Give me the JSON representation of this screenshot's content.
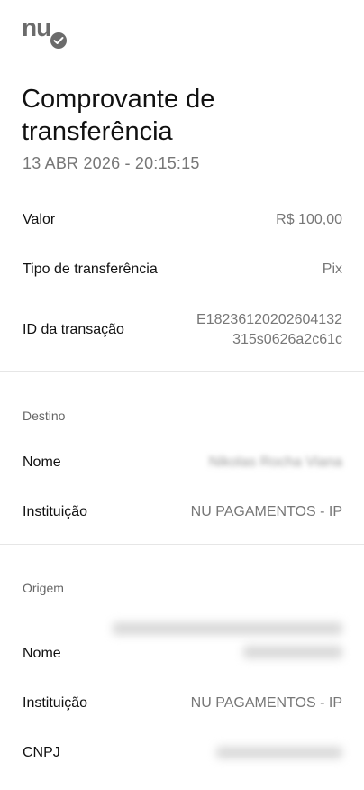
{
  "brand": {
    "logo_text": "nu"
  },
  "header": {
    "title": "Comprovante de transferência",
    "timestamp": "13 ABR 2026 - 20:15:15"
  },
  "summary": {
    "valor": {
      "label": "Valor",
      "value": "R$ 100,00"
    },
    "tipo": {
      "label": "Tipo de transferência",
      "value": "Pix"
    },
    "id": {
      "label": "ID da transação",
      "value": "E18236120202604132315s0626a2c61c"
    }
  },
  "destino": {
    "section_title": "Destino",
    "nome": {
      "label": "Nome",
      "value": "Nikolas Rocha Viana"
    },
    "instituicao": {
      "label": "Instituição",
      "value": "NU PAGAMENTOS - IP"
    }
  },
  "origem": {
    "section_title": "Origem",
    "nome": {
      "label": "Nome"
    },
    "instituicao": {
      "label": "Instituição",
      "value": "NU PAGAMENTOS - IP"
    },
    "cnpj": {
      "label": "CNPJ"
    }
  }
}
